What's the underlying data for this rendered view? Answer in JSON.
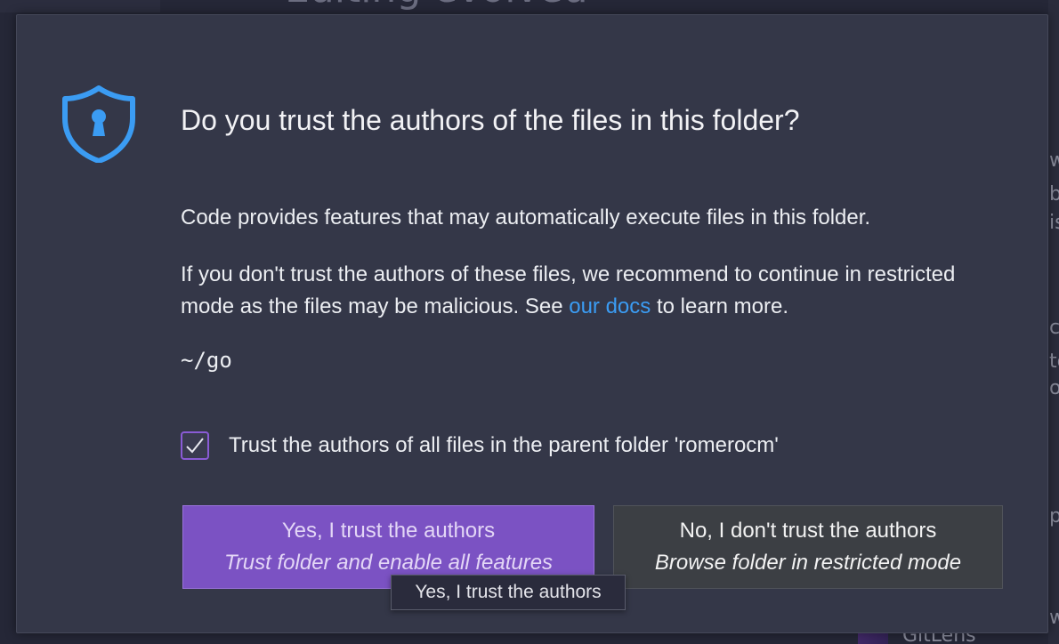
{
  "background": {
    "heading_text": "Editing evolved",
    "right_letters": [
      "w",
      "b",
      "is",
      "c",
      "to",
      "of",
      "p",
      "w"
    ],
    "bottom_text": "GitLens"
  },
  "dialog": {
    "icon": "shield-keyhole-icon",
    "title": "Do you trust the authors of the files in this folder?",
    "paragraph1": "Code provides features that may automatically execute files in this folder.",
    "paragraph2_before_link": "If you don't trust the authors of these files, we recommend to continue in restricted mode as the files may be malicious. See ",
    "paragraph2_link": "our docs",
    "paragraph2_after_link": " to learn more.",
    "folder_path": "~/go",
    "checkbox": {
      "checked": true,
      "label": "Trust the authors of all files in the parent folder 'romerocm'"
    },
    "buttons": {
      "yes": {
        "title": "Yes, I trust the authors",
        "subtitle": "Trust folder and enable all features"
      },
      "no": {
        "title": "No, I don't trust the authors",
        "subtitle": "Browse folder in restricted mode"
      }
    },
    "tooltip": "Yes, I trust the authors"
  },
  "colors": {
    "accent_blue": "#3b9cf3",
    "primary_button": "#7b52c3",
    "checkbox_border": "#8a5bd6",
    "dialog_bg": "#343748"
  }
}
